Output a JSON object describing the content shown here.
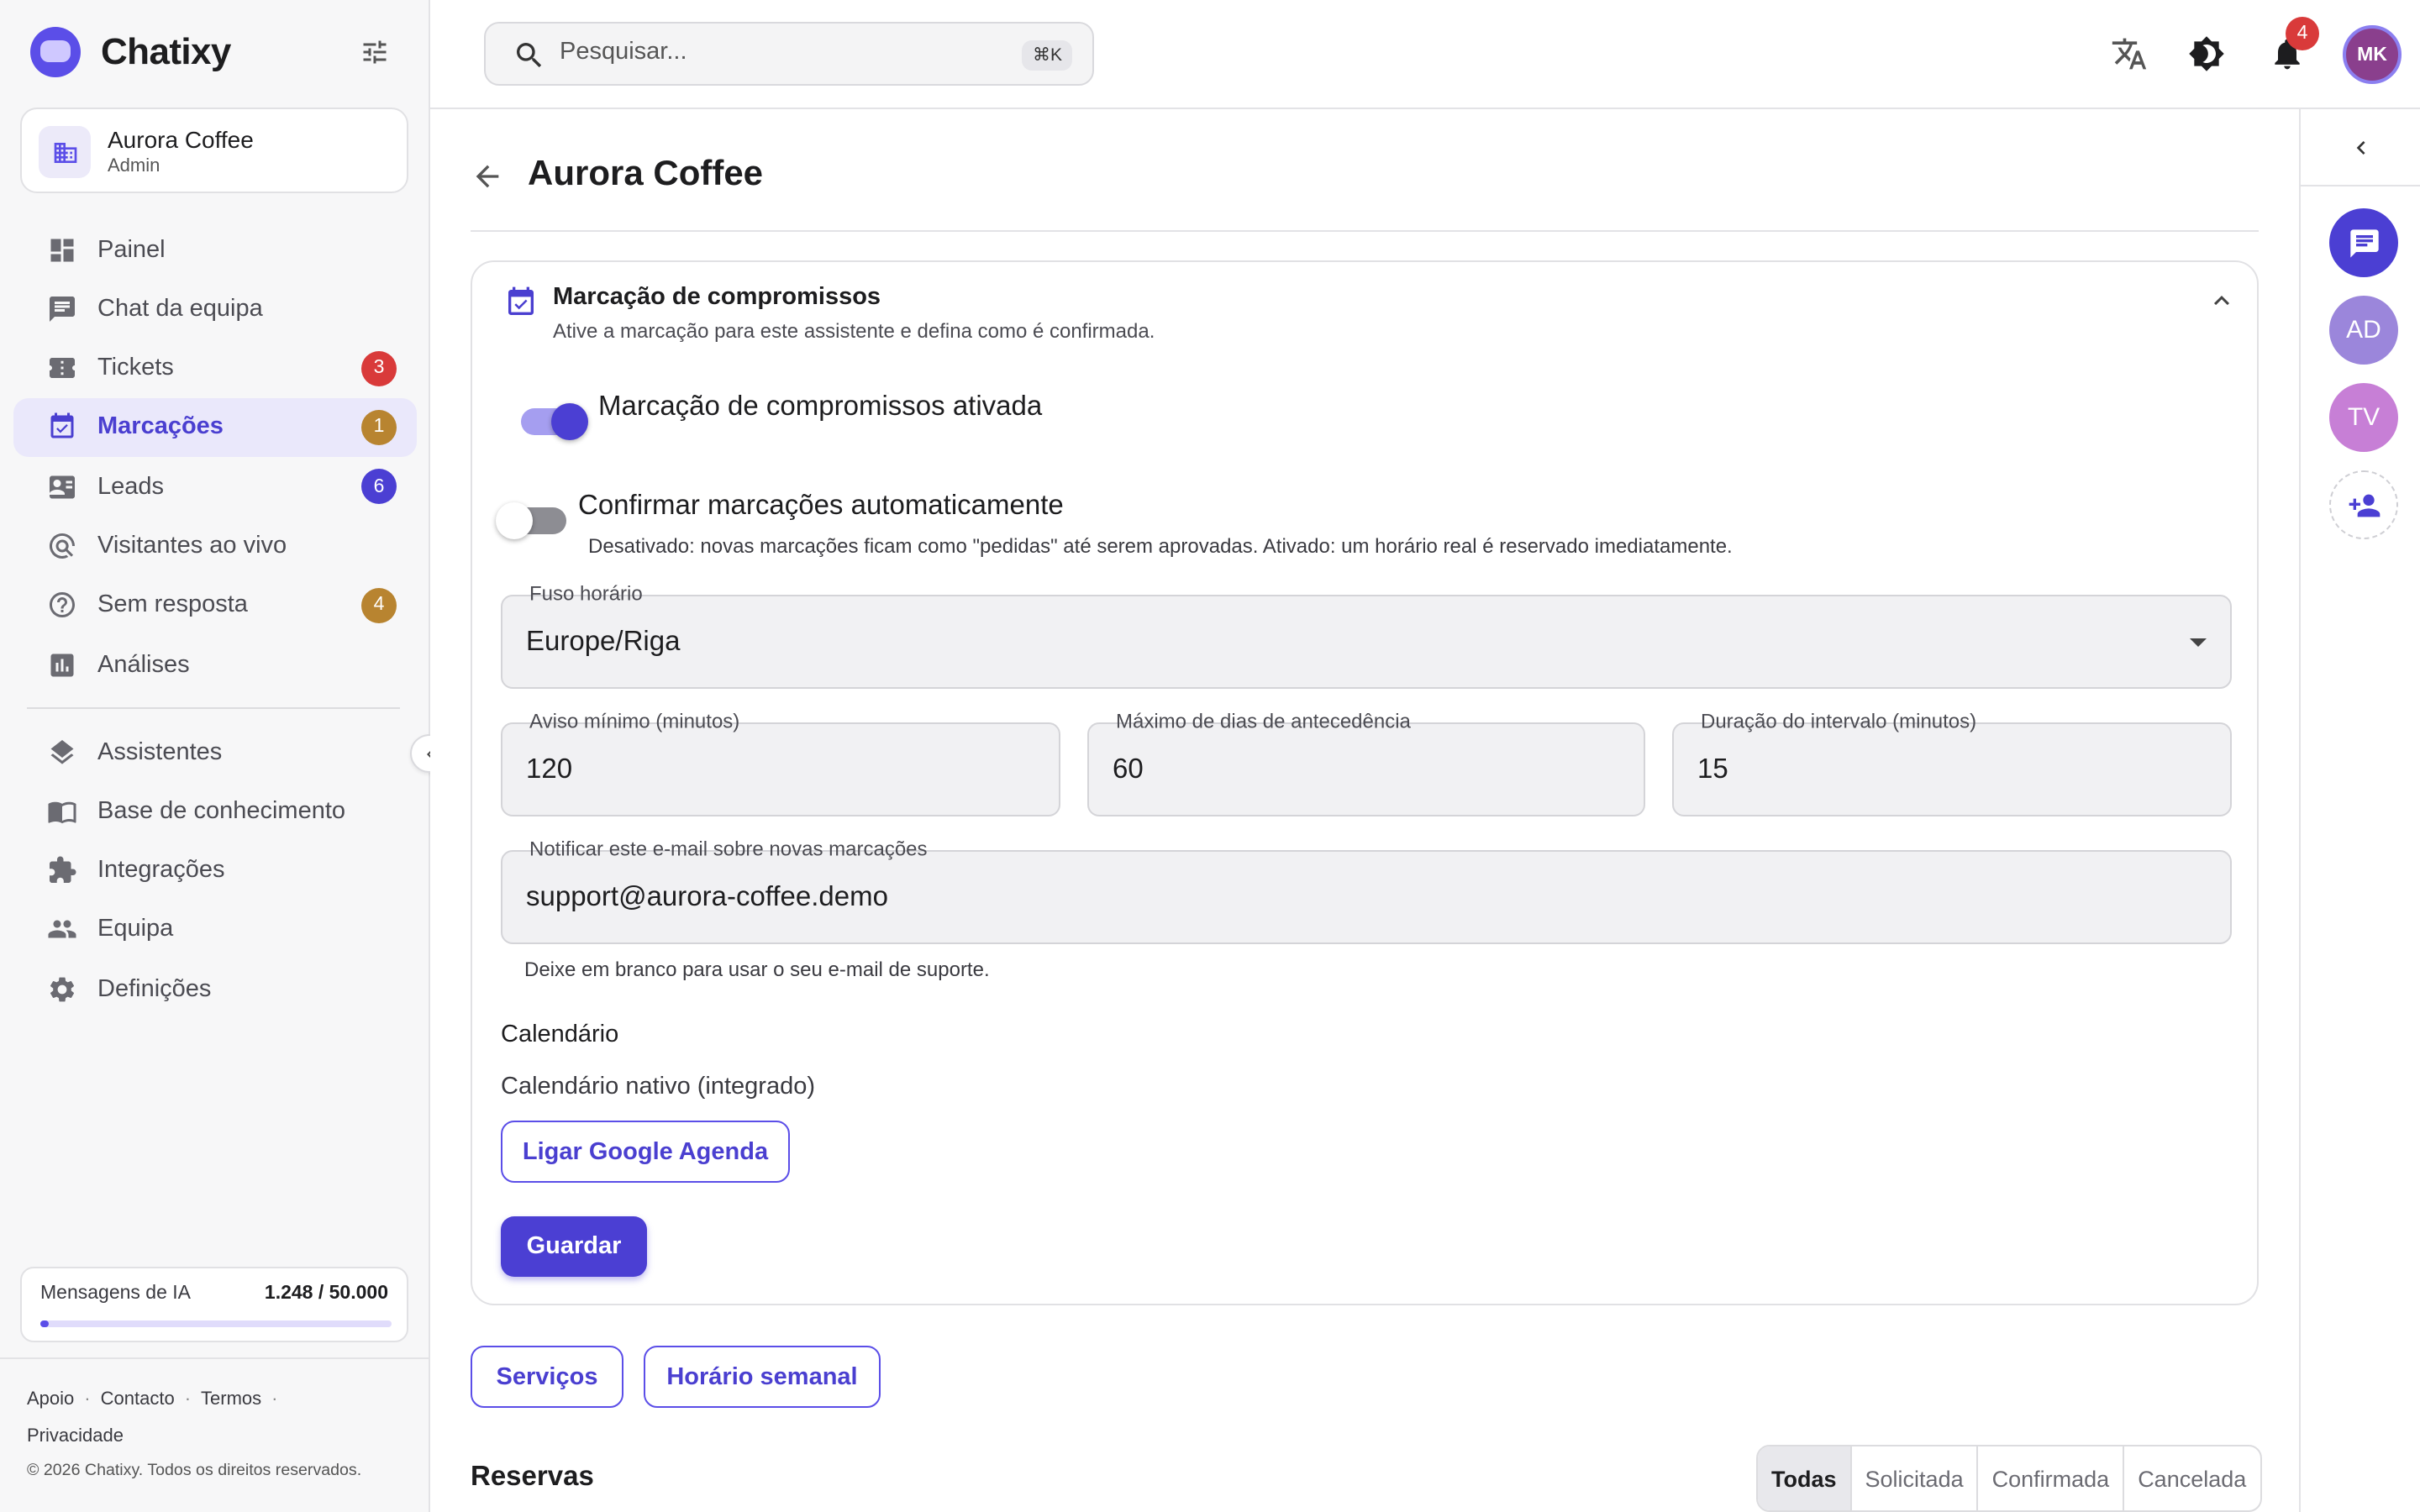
{
  "app": {
    "name": "Chatixy"
  },
  "org": {
    "name": "Aurora Coffee",
    "role": "Admin"
  },
  "nav": {
    "items": [
      {
        "key": "painel",
        "label": "Painel",
        "icon": "dashboard-icon"
      },
      {
        "key": "chat",
        "label": "Chat da equipa",
        "icon": "chat-icon"
      },
      {
        "key": "tickets",
        "label": "Tickets",
        "icon": "ticket-icon",
        "badge": "3",
        "badge_color": "#d93a3a"
      },
      {
        "key": "marcacoes",
        "label": "Marcações",
        "icon": "calendar-check-icon",
        "badge": "1",
        "badge_color": "#b88430",
        "active": true
      },
      {
        "key": "leads",
        "label": "Leads",
        "icon": "contact-card-icon",
        "badge": "6",
        "badge_color": "#4b3fd3"
      },
      {
        "key": "visitantes",
        "label": "Visitantes ao vivo",
        "icon": "visitor-search-icon"
      },
      {
        "key": "sem-resposta",
        "label": "Sem resposta",
        "icon": "help-circle-icon",
        "badge": "4",
        "badge_color": "#b88430"
      },
      {
        "key": "analises",
        "label": "Análises",
        "icon": "analytics-icon"
      }
    ],
    "items2": [
      {
        "key": "assistentes",
        "label": "Assistentes",
        "icon": "layers-icon"
      },
      {
        "key": "base",
        "label": "Base de conhecimento",
        "icon": "book-icon"
      },
      {
        "key": "integracoes",
        "label": "Integrações",
        "icon": "puzzle-icon"
      },
      {
        "key": "equipa",
        "label": "Equipa",
        "icon": "people-icon"
      },
      {
        "key": "definicoes",
        "label": "Definições",
        "icon": "gear-icon"
      }
    ]
  },
  "usage": {
    "label": "Mensagens de IA",
    "value": "1.248 / 50.000",
    "fraction": 0.025
  },
  "footer": {
    "links": [
      "Apoio",
      "Contacto",
      "Termos",
      "Privacidade"
    ],
    "copyright": "© 2026 Chatixy. Todos os direitos reservados."
  },
  "topbar": {
    "search_placeholder": "Pesquisar...",
    "search_shortcut": "⌘K",
    "notifications_count": "4",
    "user_initials": "MK"
  },
  "rail": {
    "avatars": [
      {
        "initials": "AD",
        "color": "#9b86db"
      },
      {
        "initials": "TV",
        "color": "#c77fd6"
      }
    ]
  },
  "page": {
    "title": "Aurora Coffee"
  },
  "booking": {
    "title": "Marcação de compromissos",
    "subtitle": "Ative a marcação para este assistente e defina como é confirmada.",
    "toggle_enabled_label": "Marcação de compromissos ativada",
    "toggle_enabled": true,
    "toggle_auto_label": "Confirmar marcações automaticamente",
    "toggle_auto": false,
    "auto_hint": "Desativado: novas marcações ficam como \"pedidas\" até serem aprovadas. Ativado: um horário real é reservado imediatamente.",
    "timezone_label": "Fuso horário",
    "timezone_value": "Europe/Riga",
    "min_notice_label": "Aviso mínimo (minutos)",
    "min_notice_value": "120",
    "max_days_label": "Máximo de dias de antecedência",
    "max_days_value": "60",
    "slot_label": "Duração do intervalo (minutos)",
    "slot_value": "15",
    "notify_label": "Notificar este e-mail sobre novas marcações",
    "notify_value": "support@aurora-coffee.demo",
    "notify_hint": "Deixe em branco para usar o seu e-mail de suporte.",
    "calendar_label": "Calendário",
    "calendar_value": "Calendário nativo (integrado)",
    "google_button": "Ligar Google Agenda",
    "save_button": "Guardar"
  },
  "actions": {
    "services": "Serviços",
    "weekly": "Horário semanal"
  },
  "reservas": {
    "title": "Reservas",
    "filters": [
      "Todas",
      "Solicitada",
      "Confirmada",
      "Cancelada"
    ],
    "selected": "Todas"
  },
  "colors": {
    "accent": "#4b3fd3",
    "accent_light": "#eae8fb",
    "danger": "#d93a3a",
    "warning": "#b88430"
  }
}
